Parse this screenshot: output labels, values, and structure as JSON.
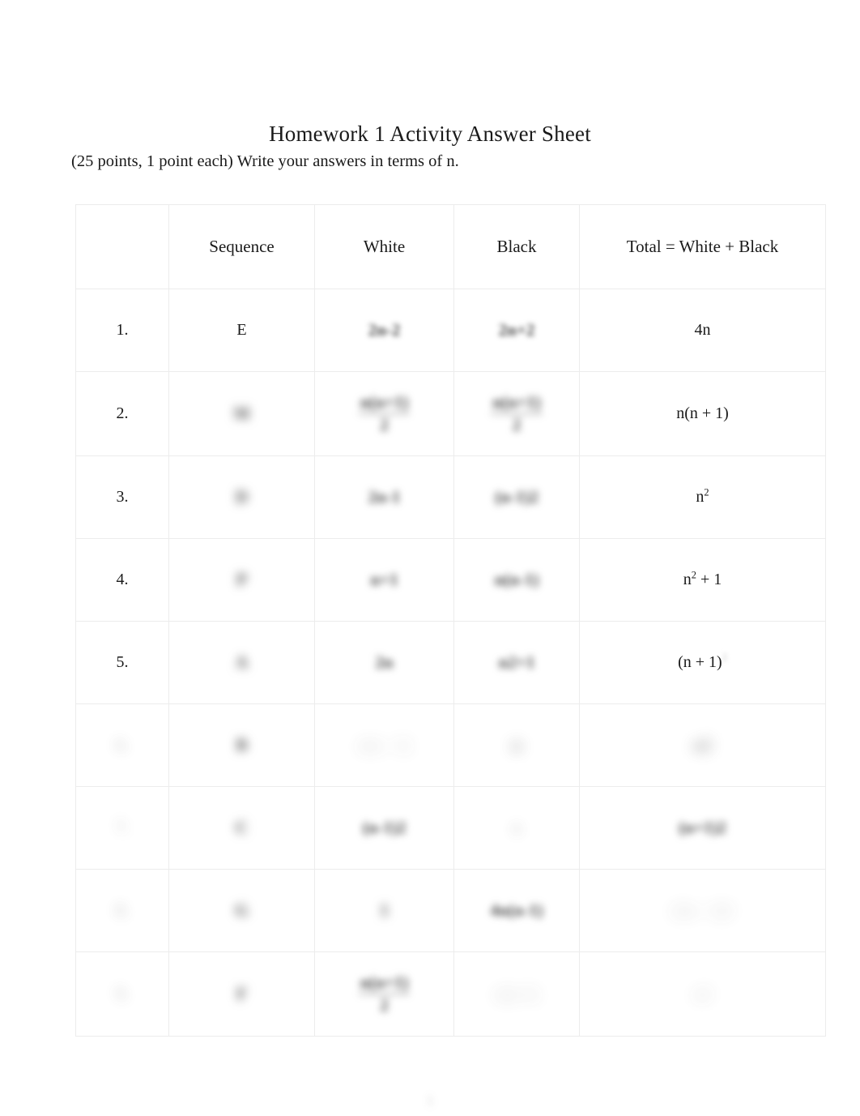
{
  "document": {
    "title": "Homework 1 Activity Answer Sheet",
    "subtitle_prefix": "(25 points, 1 point each) Write your answers in terms of ",
    "subtitle_variable": "n",
    "subtitle_suffix": ".",
    "page_number": "1"
  },
  "table": {
    "headers": {
      "number": "",
      "sequence": "Sequence",
      "white": "White",
      "black": "Black",
      "total": "Total = White + Black"
    },
    "rows": [
      {
        "number": "1.",
        "sequence": "E",
        "white": "2n-2",
        "black": "2n+2",
        "total": "4n",
        "total_sup": "",
        "white_legible": false,
        "black_legible": false,
        "sequence_legible": true,
        "number_legible": true,
        "total_legible": true
      },
      {
        "number": "2.",
        "sequence": "M",
        "white_num": "n(n+1)",
        "white_den": "2",
        "black_num": "n(n+1)",
        "black_den": "2",
        "total": "n(n + 1)",
        "total_sup": "",
        "white_legible": false,
        "black_legible": false,
        "sequence_legible": false,
        "number_legible": true,
        "total_legible": true
      },
      {
        "number": "3.",
        "sequence": "D",
        "white": "2n-1",
        "black": "(n-1)2",
        "total": "n",
        "total_sup": "2",
        "white_legible": false,
        "black_legible": false,
        "sequence_legible": false,
        "number_legible": true,
        "total_legible": true
      },
      {
        "number": "4.",
        "sequence": "P",
        "white": "n+1",
        "black": "n(n-1)",
        "total": "n",
        "total_sup": "2",
        "total_suffix": " + 1",
        "white_legible": false,
        "black_legible": false,
        "sequence_legible": false,
        "number_legible": true,
        "total_legible": true
      },
      {
        "number": "5.",
        "sequence": "A",
        "white": "2n",
        "black": "n2+1",
        "total": "(n + 1)",
        "total_sup_faint": "2",
        "white_legible": false,
        "black_legible": false,
        "sequence_legible": false,
        "number_legible": true,
        "total_legible": true
      },
      {
        "number": "6.",
        "sequence": "B",
        "white": "n(n - 1)",
        "black": "n",
        "total": "n2",
        "white_legible": false,
        "black_legible": false,
        "sequence_legible": false,
        "number_legible": false,
        "total_legible": false
      },
      {
        "number": "7.",
        "sequence": "C",
        "white": "(n-1)2",
        "black": "n",
        "total": "(n+1)2",
        "white_legible": false,
        "black_legible": false,
        "sequence_legible": false,
        "number_legible": false,
        "total_legible": false
      },
      {
        "number": "8.",
        "sequence": "G",
        "white": "1",
        "black": "4n(n-1)",
        "total": "(2n - 1)2",
        "white_legible": false,
        "black_legible": false,
        "sequence_legible": false,
        "number_legible": false,
        "total_legible": false
      },
      {
        "number": "9.",
        "sequence": "F",
        "white_num": "n(n+1)",
        "white_den": "2",
        "black": "n(n-1)",
        "total": "n2",
        "white_legible": false,
        "black_legible": false,
        "sequence_legible": false,
        "number_legible": false,
        "total_legible": false
      }
    ]
  }
}
